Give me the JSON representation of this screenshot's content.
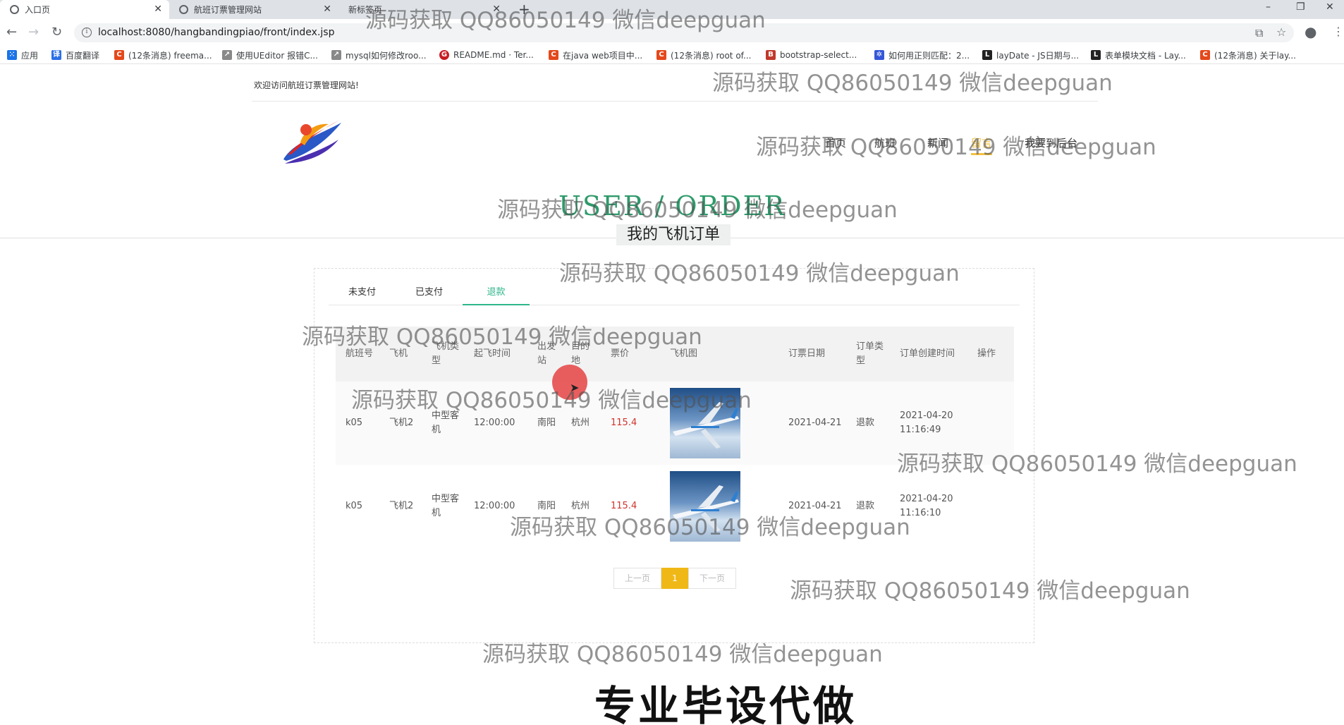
{
  "browser": {
    "tabs": [
      {
        "title": "入口页",
        "active": true
      },
      {
        "title": "航班订票管理网站",
        "active": false
      },
      {
        "title": "新标签页",
        "active": false
      }
    ],
    "url": "localhost:8080/hangbandingpiao/front/index.jsp",
    "bookmarks": [
      {
        "label": "应用",
        "icon": "apps-grid-icon",
        "color": "#1a73e8"
      },
      {
        "label": "百度翻译",
        "icon": "baidu-fanyi-icon",
        "color": "#2a6ee8"
      },
      {
        "label": "(12条消息) freema...",
        "icon": "csdn-icon",
        "color": "#e4481b"
      },
      {
        "label": "使用UEditor 报错C...",
        "icon": "link-icon",
        "color": "#555555"
      },
      {
        "label": "mysql如何修改roo...",
        "icon": "link-icon",
        "color": "#555555"
      },
      {
        "label": "README.md · Ter...",
        "icon": "gitee-icon",
        "color": "#c71d23"
      },
      {
        "label": "在java web项目中...",
        "icon": "csdn-icon",
        "color": "#e4481b"
      },
      {
        "label": "(12条消息) root of...",
        "icon": "csdn-icon",
        "color": "#e4481b"
      },
      {
        "label": "bootstrap-select...",
        "icon": "bootstrap-icon",
        "color": "#c0392b"
      },
      {
        "label": "如何用正则匹配：2...",
        "icon": "zhihu-icon",
        "color": "#3556d8"
      },
      {
        "label": "layDate - JS日期与...",
        "icon": "layui-icon",
        "color": "#222222"
      },
      {
        "label": "表单模块文档 - Lay...",
        "icon": "layui-icon",
        "color": "#222222"
      },
      {
        "label": "(12条消息) 关于lay...",
        "icon": "csdn-icon",
        "color": "#e4481b"
      }
    ]
  },
  "site": {
    "welcome": "欢迎访问航班订票管理网站!",
    "nav": [
      {
        "label": "首页",
        "active": false
      },
      {
        "label": "航班",
        "active": false
      },
      {
        "label": "新闻",
        "active": false
      },
      {
        "label": "留言",
        "active": true
      },
      {
        "label": "我要到后台",
        "active": false
      }
    ],
    "section_title_en": "USER / ORDER",
    "section_title_cn": "我的飞机订单"
  },
  "orders": {
    "tabs": [
      {
        "label": "未支付",
        "active": false
      },
      {
        "label": "已支付",
        "active": false
      },
      {
        "label": "退款",
        "active": true
      }
    ],
    "columns": [
      "航班号",
      "飞机",
      "飞机类型",
      "起飞时间",
      "出发站",
      "目的地",
      "票价",
      "飞机图",
      "订票日期",
      "订单类型",
      "订单创建时间",
      "操作"
    ],
    "rows": [
      {
        "flight": "k05",
        "plane": "飞机2",
        "type": "中型客机",
        "depart": "12:00:00",
        "from": "南阳",
        "to": "杭州",
        "price": "115.4",
        "image": "airplane-photo",
        "date": "2021-04-21",
        "status": "退款",
        "created": "2021-04-20 11:16:49",
        "action": ""
      },
      {
        "flight": "k05",
        "plane": "飞机2",
        "type": "中型客机",
        "depart": "12:00:00",
        "from": "南阳",
        "to": "杭州",
        "price": "115.4",
        "image": "airplane-photo",
        "date": "2021-04-21",
        "status": "退款",
        "created": "2021-04-20 11:16:10",
        "action": ""
      }
    ],
    "pager": {
      "prev": "上一页",
      "current": "1",
      "next": "下一页"
    }
  },
  "overlay": {
    "watermark": "源码获取 QQ86050149 微信deepguan",
    "promo": "专业毕设代做"
  },
  "colors": {
    "accent_green": "#2fb68a",
    "nav_active": "#f4c242",
    "price_red": "#d0342c",
    "pager_active": "#f0b817"
  }
}
